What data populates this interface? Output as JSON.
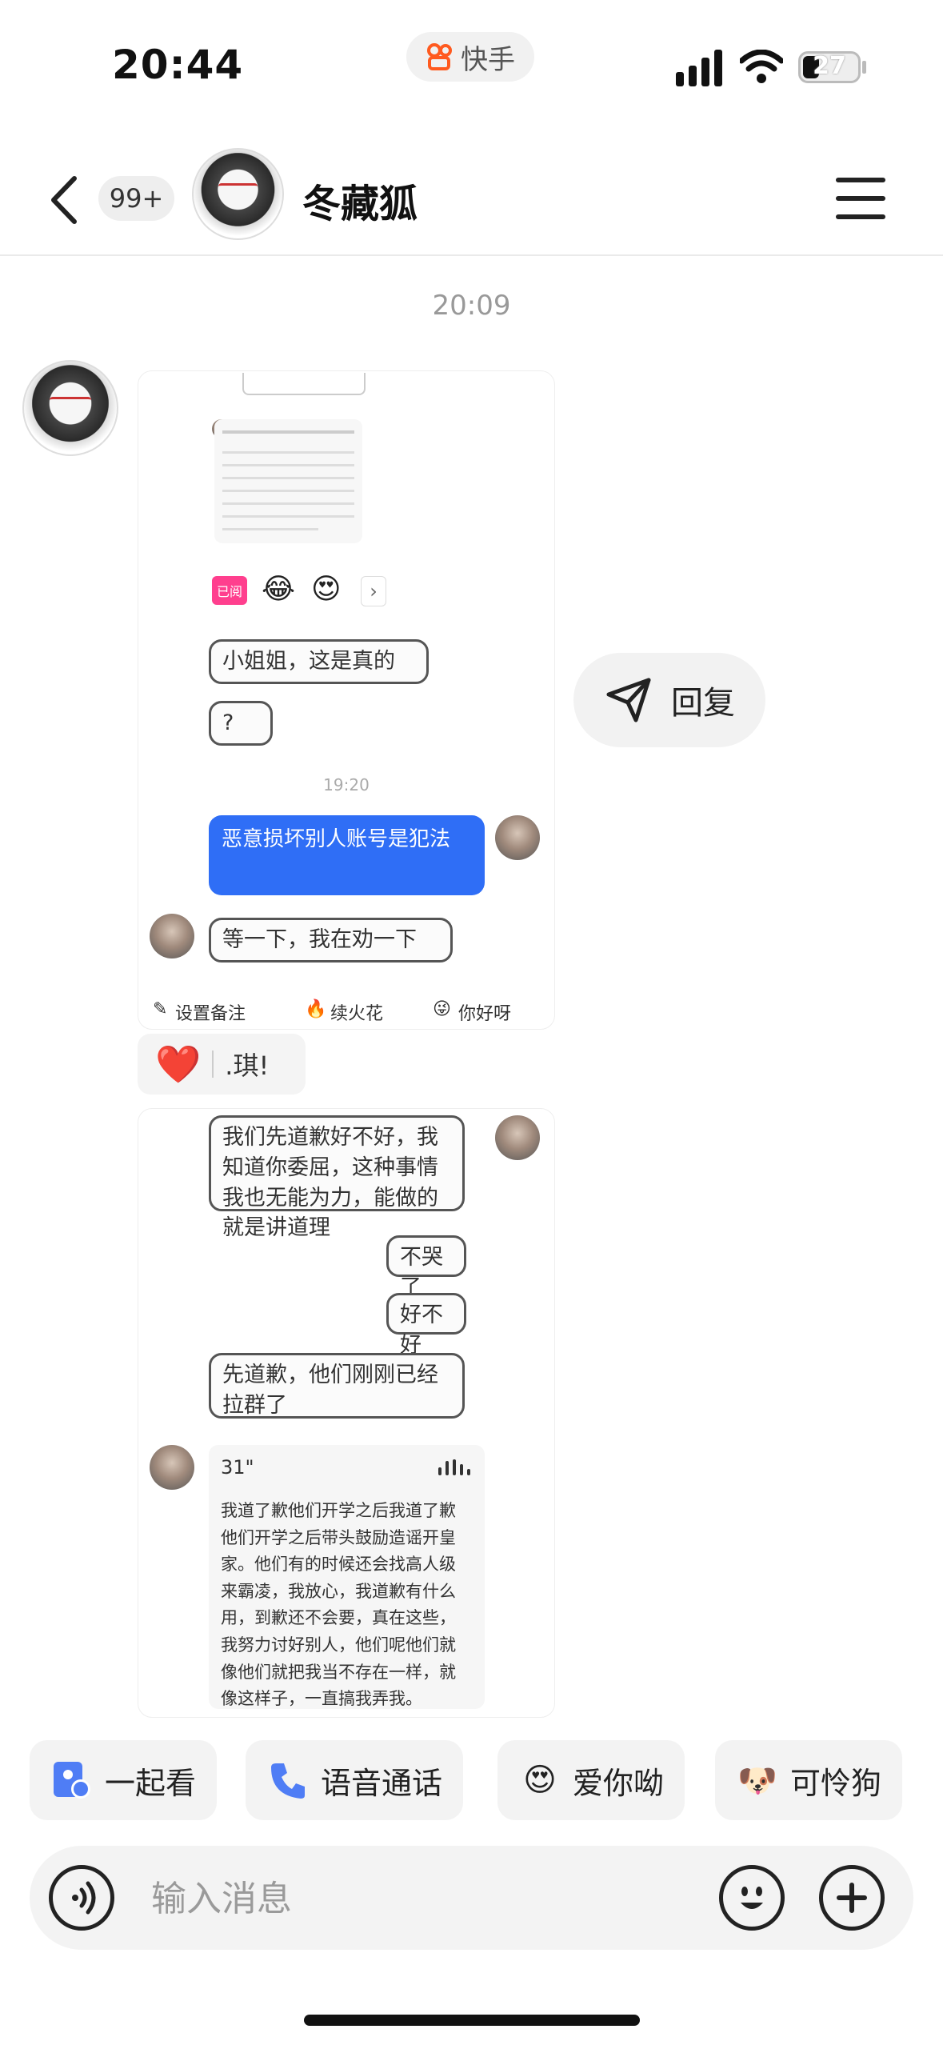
{
  "status_bar": {
    "time": "20:44",
    "app_name": "快手",
    "battery": "27"
  },
  "header": {
    "unread_badge": "99+",
    "contact_name": "冬藏狐"
  },
  "chat": {
    "timestamp": "20:09",
    "screenshot1": {
      "bubbles": [
        "小姐姐，这是真的",
        "?",
        "恶意损坏别人账号是犯法",
        "等一下，我在劝一下"
      ],
      "inner_time": "19:20",
      "reaction_chip": "已阅",
      "tools": [
        "设置备注",
        "续火花",
        "你好呀"
      ]
    },
    "reply_button": "回复",
    "reaction": {
      "emoji": "❤️",
      "name": ".琪!"
    },
    "screenshot2": {
      "bubbles": [
        "我们先道歉好不好，我知道你委屈，这种事情我也无能为力，能做的就是讲道理",
        "不哭了",
        "好不好",
        "先道歉，他们刚刚已经拉群了"
      ],
      "voice": {
        "duration": "31\"",
        "transcript": "我道了歉他们开学之后我道了歉他们开学之后带头鼓励造谣开皇家。他们有的时候还会找高人级来霸凌，我放心，我道歉有什么用，到歉还不会要，真在这些，我努力讨好别人，他们呢他们就像他们就把我当不存在一样，就像这样子，一直搞我弄我。"
      }
    }
  },
  "quick_actions": [
    {
      "label": "一起看",
      "icon": "watch-together-icon"
    },
    {
      "label": "语音通话",
      "icon": "phone-icon"
    },
    {
      "label": "爱你呦",
      "icon": "heart-eyes-emoji-icon"
    },
    {
      "label": "可怜狗",
      "icon": "pitiful-dog-emoji-icon"
    }
  ],
  "input": {
    "placeholder": "输入消息"
  },
  "colors": {
    "accent_blue": "#2f6ef6",
    "reaction_red": "#e83b2e"
  }
}
